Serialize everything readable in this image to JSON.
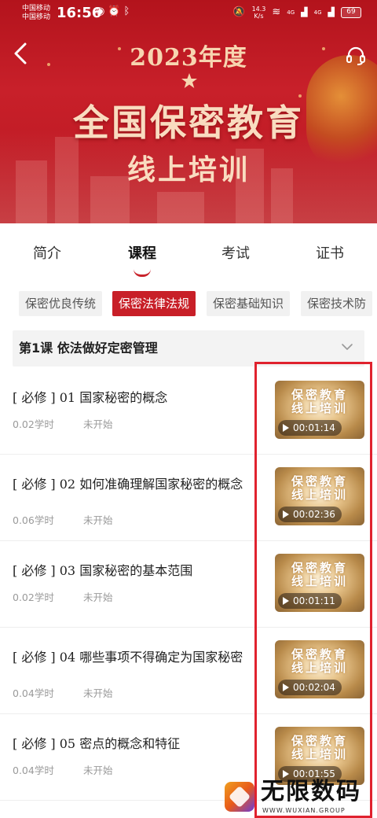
{
  "status_bar": {
    "carrier_1": "中国移动",
    "carrier_2": "中国移动",
    "time": "16:56",
    "net_speed_value": "14.3",
    "net_speed_unit": "K/s",
    "signal_1": "4G",
    "signal_2": "4G",
    "battery": "69"
  },
  "banner": {
    "year": "2023年度",
    "title": "全国保密教育",
    "subtitle": "线上培训"
  },
  "tabs": [
    {
      "label": "简介",
      "active": false
    },
    {
      "label": "课程",
      "active": true
    },
    {
      "label": "考试",
      "active": false
    },
    {
      "label": "证书",
      "active": false
    }
  ],
  "categories": [
    {
      "label": "保密优良传统",
      "active": false
    },
    {
      "label": "保密法律法规",
      "active": true
    },
    {
      "label": "保密基础知识",
      "active": false
    },
    {
      "label": "保密技术防",
      "active": false
    }
  ],
  "lesson": {
    "title": "第1课  依法做好定密管理"
  },
  "courses": [
    {
      "title": "[ 必修 ] 01  国家秘密的概念",
      "hours": "0.02学时",
      "status": "未开始",
      "duration": "00:01:14",
      "thumb_text": "保密教育 线上培训"
    },
    {
      "title": "[ 必修 ] 02  如何准确理解国家秘密的概念",
      "hours": "0.06学时",
      "status": "未开始",
      "duration": "00:02:36",
      "thumb_text": "保密教育 线上培训"
    },
    {
      "title": "[ 必修 ] 03  国家秘密的基本范围",
      "hours": "0.02学时",
      "status": "未开始",
      "duration": "00:01:11",
      "thumb_text": "保密教育 线上培训"
    },
    {
      "title": "[ 必修 ] 04  哪些事项不得确定为国家秘密",
      "hours": "0.04学时",
      "status": "未开始",
      "duration": "00:02:04",
      "thumb_text": "保密教育 线上培训"
    },
    {
      "title": "[ 必修 ] 05  密点的概念和特征",
      "hours": "0.04学时",
      "status": "未开始",
      "duration": "00:01:55",
      "thumb_text": "保密教育 线上培训"
    }
  ],
  "watermark": {
    "brand": "无限数码",
    "url": "WWW.WUXIAN.GROUP"
  },
  "colors": {
    "brand_red": "#c81f28",
    "annotation_red": "#e0222e"
  },
  "icons": {
    "back": "chevron-left-icon",
    "service": "headset-icon",
    "collapse": "chevron-down-icon",
    "play": "play-icon"
  }
}
